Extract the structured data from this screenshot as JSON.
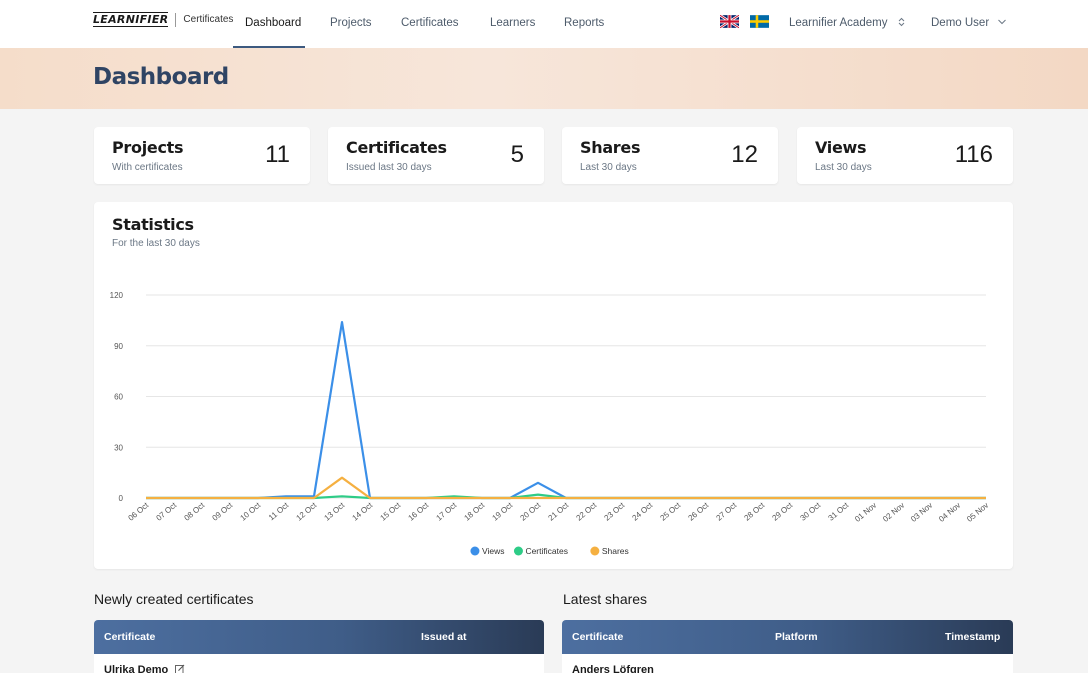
{
  "brand": {
    "logo_text": "LEARNIFIER",
    "product": "Certificates"
  },
  "nav": {
    "items": [
      {
        "label": "Dashboard",
        "active": true
      },
      {
        "label": "Projects"
      },
      {
        "label": "Certificates"
      },
      {
        "label": "Learners"
      },
      {
        "label": "Reports"
      }
    ],
    "languages": [
      "English",
      "Swedish"
    ],
    "organization": "Learnifier Academy",
    "user": "Demo User"
  },
  "page": {
    "title": "Dashboard"
  },
  "stats_cards": [
    {
      "title": "Projects",
      "subtitle": "With certificates",
      "value": "11"
    },
    {
      "title": "Certificates",
      "subtitle": "Issued last 30 days",
      "value": "5"
    },
    {
      "title": "Shares",
      "subtitle": "Last 30 days",
      "value": "12"
    },
    {
      "title": "Views",
      "subtitle": "Last 30 days",
      "value": "116"
    }
  ],
  "statistics": {
    "title": "Statistics",
    "subtitle": "For the last 30 days"
  },
  "chart_data": {
    "type": "line",
    "title": "",
    "xlabel": "",
    "ylabel": "",
    "ylim": [
      0,
      120
    ],
    "yticks": [
      0,
      30,
      60,
      90,
      120
    ],
    "grid": true,
    "legend": "bottom",
    "x": [
      "06 Oct",
      "07 Oct",
      "08 Oct",
      "09 Oct",
      "10 Oct",
      "11 Oct",
      "12 Oct",
      "13 Oct",
      "14 Oct",
      "15 Oct",
      "16 Oct",
      "17 Oct",
      "18 Oct",
      "19 Oct",
      "20 Oct",
      "21 Oct",
      "22 Oct",
      "23 Oct",
      "24 Oct",
      "25 Oct",
      "26 Oct",
      "27 Oct",
      "28 Oct",
      "29 Oct",
      "30 Oct",
      "31 Oct",
      "01 Nov",
      "02 Nov",
      "03 Nov",
      "04 Nov",
      "05 Nov"
    ],
    "series": [
      {
        "name": "Views",
        "color": "#3b8fe8",
        "values": [
          0,
          0,
          0,
          0,
          0,
          1,
          1,
          104,
          0,
          0,
          0,
          0,
          0,
          0,
          9,
          0,
          0,
          0,
          0,
          0,
          0,
          0,
          0,
          0,
          0,
          0,
          0,
          0,
          0,
          0,
          0
        ]
      },
      {
        "name": "Certificates",
        "color": "#2ecc87",
        "values": [
          0,
          0,
          0,
          0,
          0,
          0,
          0,
          1,
          0,
          0,
          0,
          1,
          0,
          0,
          2,
          0,
          0,
          0,
          0,
          0,
          0,
          0,
          0,
          0,
          0,
          0,
          0,
          0,
          0,
          0,
          0
        ]
      },
      {
        "name": "Shares",
        "color": "#f5b041",
        "values": [
          0,
          0,
          0,
          0,
          0,
          0,
          0,
          12,
          0,
          0,
          0,
          0,
          0,
          0,
          0,
          0,
          0,
          0,
          0,
          0,
          0,
          0,
          0,
          0,
          0,
          0,
          0,
          0,
          0,
          0,
          0
        ]
      }
    ]
  },
  "new_certificates": {
    "title": "Newly created certificates",
    "columns": [
      "Certificate",
      "Issued at"
    ],
    "rows": [
      {
        "certificate": "Ulrika Demo"
      }
    ]
  },
  "latest_shares": {
    "title": "Latest shares",
    "columns": [
      "Certificate",
      "Platform",
      "Timestamp"
    ],
    "rows": [
      {
        "certificate": "Anders Löfgren"
      }
    ]
  }
}
